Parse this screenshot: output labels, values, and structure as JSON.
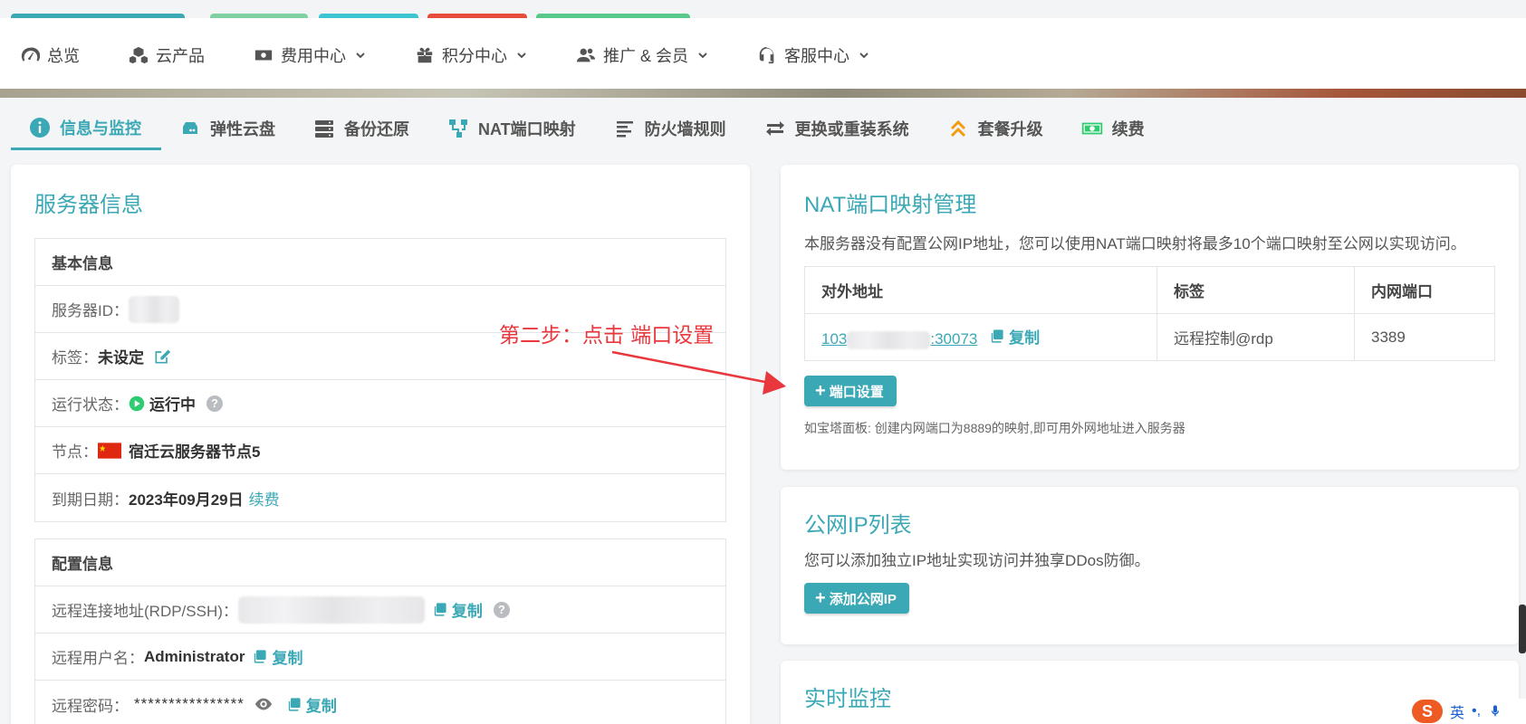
{
  "top_strip_colors": [
    "#3aa8b5",
    "#7fd1a1",
    "#3ec5d3",
    "#e74c3c",
    "#58c98a"
  ],
  "nav": {
    "items": [
      {
        "label": "总览",
        "icon": "speedometer-icon",
        "dropdown": false
      },
      {
        "label": "云产品",
        "icon": "cubes-icon",
        "dropdown": false
      },
      {
        "label": "费用中心",
        "icon": "money-icon",
        "dropdown": true
      },
      {
        "label": "积分中心",
        "icon": "gift-icon",
        "dropdown": true
      },
      {
        "label": "推广 & 会员",
        "icon": "users-icon",
        "dropdown": true
      },
      {
        "label": "客服中心",
        "icon": "headset-icon",
        "dropdown": true
      }
    ]
  },
  "subtabs": [
    {
      "label": "信息与监控",
      "icon": "info-icon",
      "active": true
    },
    {
      "label": "弹性云盘",
      "icon": "hdd-icon",
      "active": false
    },
    {
      "label": "备份还原",
      "icon": "server-icon",
      "active": false
    },
    {
      "label": "NAT端口映射",
      "icon": "sitemap-icon",
      "active": false
    },
    {
      "label": "防火墙规则",
      "icon": "align-left-icon",
      "active": false
    },
    {
      "label": "更换或重装系统",
      "icon": "exchange-icon",
      "active": false
    },
    {
      "label": "套餐升级",
      "icon": "double-up-icon",
      "active": false
    },
    {
      "label": "续费",
      "icon": "money-bill-icon",
      "active": false
    }
  ],
  "server_info": {
    "title": "服务器信息",
    "basic": {
      "heading": "基本信息",
      "server_id_label": "服务器ID：",
      "tag_label": "标签：",
      "tag_value": "未设定",
      "status_label": "运行状态：",
      "status_value": "运行中",
      "node_label": "节点：",
      "node_value": "宿迁云服务器节点5",
      "expire_label": "到期日期：",
      "expire_value": "2023年09月29日",
      "renew_link": "续费"
    },
    "config": {
      "heading": "配置信息",
      "remote_addr_label": "远程连接地址(RDP/SSH)：",
      "username_label": "远程用户名：",
      "username_value": "Administrator",
      "password_label": "远程密码：",
      "password_value": "****************",
      "copy_label": "复制"
    }
  },
  "nat": {
    "title": "NAT端口映射管理",
    "desc": "本服务器没有配置公网IP地址，您可以使用NAT端口映射将最多10个端口映射至公网以实现访问。",
    "columns": [
      "对外地址",
      "标签",
      "内网端口"
    ],
    "rows": [
      {
        "addr_prefix": "103",
        "addr_suffix": ":30073",
        "copy": "复制",
        "tag": "远程控制@rdp",
        "port": "3389"
      }
    ],
    "button": "端口设置",
    "hint": "如宝塔面板: 创建内网端口为8889的映射,即可用外网地址进入服务器"
  },
  "public_ip": {
    "title": "公网IP列表",
    "desc": "您可以添加独立IP地址实现访问并独享DDos防御。",
    "button": "添加公网IP"
  },
  "monitor": {
    "title": "实时监控"
  },
  "annotation": {
    "text": "第二步：点击 端口设置",
    "color": "#e8383d"
  },
  "ime": {
    "logo": "S",
    "lang": "英",
    "punct": "•,"
  },
  "colors": {
    "accent": "#3aa8b5",
    "status_green": "#2ecc71"
  }
}
